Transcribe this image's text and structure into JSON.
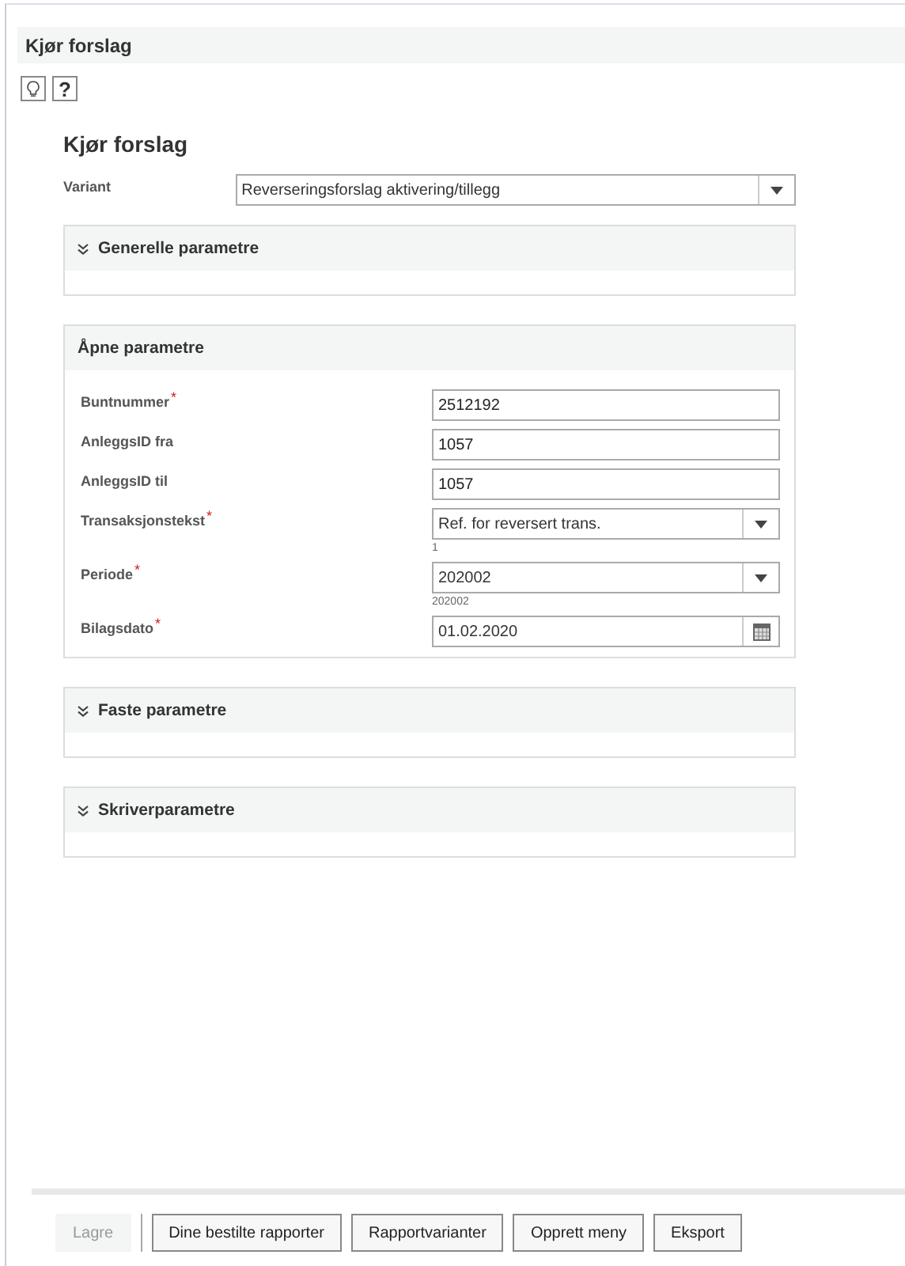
{
  "header": {
    "title": "Kjør forslag"
  },
  "toolbar": [
    {
      "kind": "bulb"
    },
    {
      "kind": "help",
      "label": "?"
    }
  ],
  "page_title": "Kjør forslag",
  "required_mark": "*",
  "variant": {
    "label": "Variant",
    "value": "Reverseringsforslag aktivering/tillegg"
  },
  "sections": [
    {
      "title": "Generelle parametre",
      "expanded": false
    },
    {
      "title": "Åpne parametre",
      "expanded": true,
      "fields": [
        {
          "label": "Buntnummer",
          "required": true,
          "kind": "text",
          "value": "2512192"
        },
        {
          "label": "AnleggsID fra",
          "required": false,
          "kind": "text",
          "value": "1057"
        },
        {
          "label": "AnleggsID til",
          "required": false,
          "kind": "text",
          "value": "1057"
        },
        {
          "label": "Transaksjonstekst",
          "required": true,
          "kind": "select",
          "value": "Ref. for reversert trans.",
          "hint": "1"
        },
        {
          "label": "Periode",
          "required": true,
          "kind": "select",
          "value": "202002",
          "hint": "202002"
        },
        {
          "label": "Bilagsdato",
          "required": true,
          "kind": "date",
          "value": "01.02.2020"
        }
      ]
    },
    {
      "title": "Faste parametre",
      "expanded": false
    },
    {
      "title": "Skriverparametre",
      "expanded": false
    }
  ],
  "buttons": [
    {
      "label": "Lagre",
      "disabled": true
    },
    {
      "label": "Dine bestilte rapporter",
      "disabled": false
    },
    {
      "label": "Rapportvarianter",
      "disabled": false
    },
    {
      "label": "Opprett meny",
      "disabled": false
    },
    {
      "label": "Eksport",
      "disabled": false
    }
  ]
}
